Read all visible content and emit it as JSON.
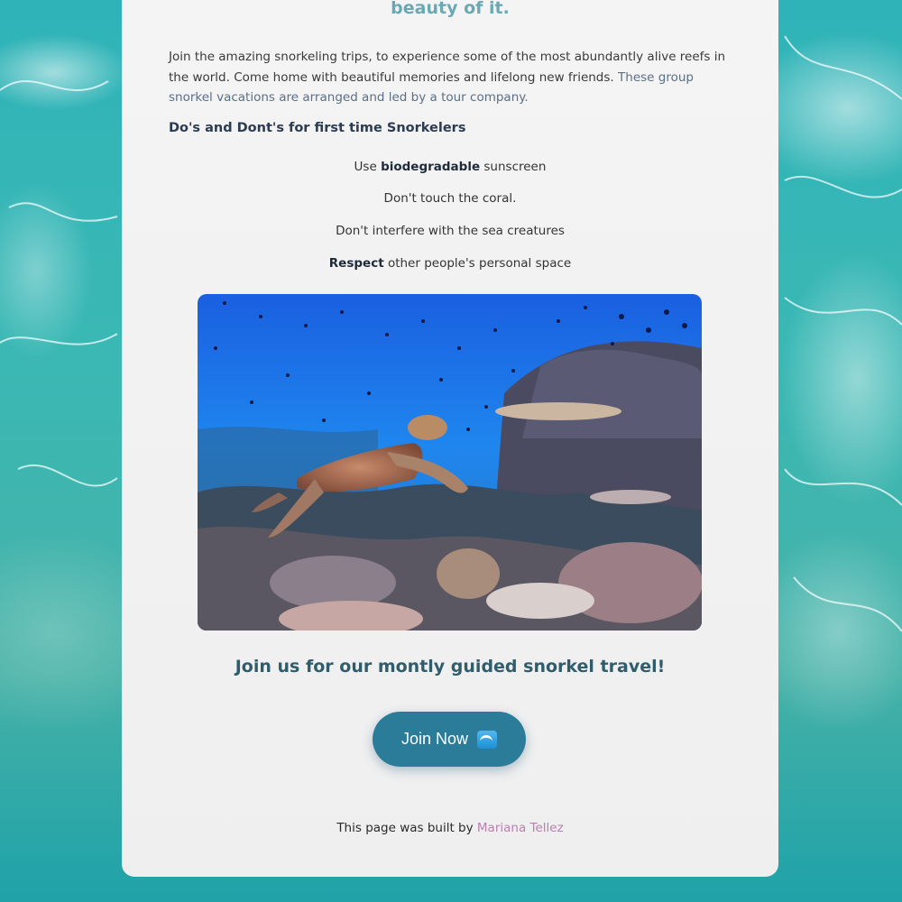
{
  "heading_top": "beauty of it.",
  "intro": {
    "text": "Join the amazing snorkeling trips, to experience some of the most abundantly alive reefs in the world. Come home with beautiful memories and lifelong new friends.",
    "muted_text": "These group snorkel vacations are arranged and led by a tour company."
  },
  "dos_heading": "Do's and Dont's for first time Snorkelers",
  "tips": [
    {
      "pre": "Use ",
      "bold": "biodegradable",
      "post": " sunscreen"
    },
    {
      "pre": "Don't touch the coral.",
      "bold": "",
      "post": ""
    },
    {
      "pre": "Don't interfere with the sea creatures",
      "bold": "",
      "post": ""
    },
    {
      "pre": "",
      "bold": "Respect",
      "post": " other people's personal space"
    }
  ],
  "cta_heading": "Join us for our montly guided snorkel travel!",
  "join_button": {
    "label": "Join Now",
    "icon": "water-wave-icon"
  },
  "footer": {
    "text": "This page was built by ",
    "author": "Mariana Tellez"
  },
  "colors": {
    "accent": "#2a7c98",
    "heading_teal": "#6aa9b4",
    "author_link": "#b97fae"
  }
}
